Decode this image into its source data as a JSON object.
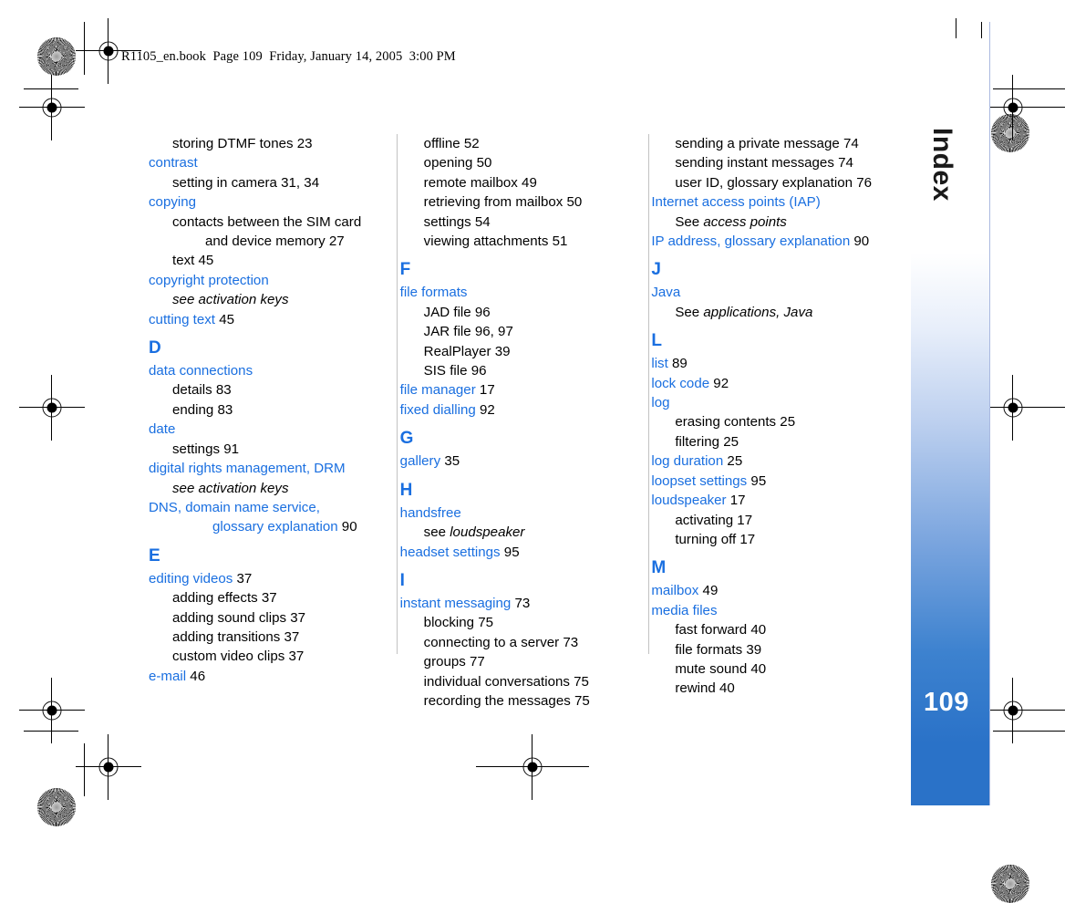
{
  "header": {
    "text": "R1105_en.book  Page 109  Friday, January 14, 2005  3:00 PM"
  },
  "sidebar": {
    "label": "Index",
    "page_number": "109",
    "gradient_top": "#ffffff",
    "gradient_bottom": "#2a72c8"
  },
  "colors": {
    "entry_blue": "#1a6fe0",
    "body_black": "#000000",
    "divider_gray": "#c2c2c2",
    "trim_blue": "#aab9e0"
  },
  "columns": [
    {
      "id": "column-1",
      "blocks": [
        {
          "type": "sub",
          "text": "storing DTMF tones",
          "page": "23"
        },
        {
          "type": "head",
          "text": "contrast"
        },
        {
          "type": "sub",
          "text": "setting in camera",
          "page": "31, 34"
        },
        {
          "type": "head",
          "text": "copying"
        },
        {
          "type": "sub",
          "text": "contacts between the SIM card and device memory",
          "page": "27",
          "hang": true
        },
        {
          "type": "sub",
          "text": "text",
          "page": "45"
        },
        {
          "type": "head",
          "text": "copyright protection"
        },
        {
          "type": "xref",
          "see": "",
          "target": "see activation keys"
        },
        {
          "type": "head",
          "text": "cutting text",
          "page": "45"
        },
        {
          "type": "letter",
          "text": "D"
        },
        {
          "type": "head",
          "text": "data connections"
        },
        {
          "type": "sub",
          "text": "details",
          "page": "83"
        },
        {
          "type": "sub",
          "text": "ending",
          "page": "83"
        },
        {
          "type": "head",
          "text": "date"
        },
        {
          "type": "sub",
          "text": "settings",
          "page": "91"
        },
        {
          "type": "head",
          "text": "digital rights management, DRM"
        },
        {
          "type": "xref",
          "see": "",
          "target": "see activation keys"
        },
        {
          "type": "head",
          "text": "DNS, domain name service, glossary explanation",
          "page": "90",
          "hang": true
        },
        {
          "type": "letter",
          "text": "E"
        },
        {
          "type": "head",
          "text": "editing videos",
          "page": "37"
        },
        {
          "type": "sub",
          "text": "adding effects",
          "page": "37"
        },
        {
          "type": "sub",
          "text": "adding sound clips",
          "page": "37"
        },
        {
          "type": "sub",
          "text": "adding transitions",
          "page": "37"
        },
        {
          "type": "sub",
          "text": "custom video clips",
          "page": "37"
        },
        {
          "type": "head",
          "text": "e-mail",
          "page": "46"
        }
      ]
    },
    {
      "id": "column-2",
      "blocks": [
        {
          "type": "sub",
          "text": "offline",
          "page": "52"
        },
        {
          "type": "sub",
          "text": "opening",
          "page": "50"
        },
        {
          "type": "sub",
          "text": "remote mailbox",
          "page": "49"
        },
        {
          "type": "sub",
          "text": "retrieving from mailbox",
          "page": "50"
        },
        {
          "type": "sub",
          "text": "settings",
          "page": "54"
        },
        {
          "type": "sub",
          "text": "viewing attachments",
          "page": "51"
        },
        {
          "type": "letter",
          "text": "F"
        },
        {
          "type": "head",
          "text": "file formats"
        },
        {
          "type": "sub",
          "text": "JAD file",
          "page": "96"
        },
        {
          "type": "sub",
          "text": "JAR file",
          "page": "96, 97"
        },
        {
          "type": "sub",
          "text": "RealPlayer",
          "page": "39"
        },
        {
          "type": "sub",
          "text": "SIS file",
          "page": "96"
        },
        {
          "type": "head",
          "text": "file manager",
          "page": "17"
        },
        {
          "type": "head",
          "text": "fixed dialling",
          "page": "92"
        },
        {
          "type": "letter",
          "text": "G"
        },
        {
          "type": "head",
          "text": "gallery",
          "page": "35"
        },
        {
          "type": "letter",
          "text": "H"
        },
        {
          "type": "head",
          "text": "handsfree"
        },
        {
          "type": "xref",
          "see": "see ",
          "target": "loudspeaker"
        },
        {
          "type": "head",
          "text": "headset settings",
          "page": "95"
        },
        {
          "type": "letter",
          "text": "I"
        },
        {
          "type": "head",
          "text": "instant messaging",
          "page": "73"
        },
        {
          "type": "sub",
          "text": "blocking",
          "page": "75"
        },
        {
          "type": "sub",
          "text": "connecting to a server",
          "page": "73"
        },
        {
          "type": "sub",
          "text": "groups",
          "page": "77"
        },
        {
          "type": "sub",
          "text": "individual conversations",
          "page": "75"
        },
        {
          "type": "sub",
          "text": "recording the messages",
          "page": "75"
        }
      ]
    },
    {
      "id": "column-3",
      "blocks": [
        {
          "type": "sub",
          "text": "sending a private message",
          "page": "74"
        },
        {
          "type": "sub",
          "text": "sending instant messages",
          "page": "74"
        },
        {
          "type": "sub",
          "text": "user ID, glossary explanation",
          "page": "76"
        },
        {
          "type": "head",
          "text": "Internet access points (IAP)"
        },
        {
          "type": "xref",
          "see": "See ",
          "target": "access points"
        },
        {
          "type": "head",
          "text": "IP address, glossary explanation",
          "page": "90"
        },
        {
          "type": "letter",
          "text": "J"
        },
        {
          "type": "head",
          "text": "Java"
        },
        {
          "type": "xref",
          "see": "See ",
          "target": "applications, Java"
        },
        {
          "type": "letter",
          "text": "L"
        },
        {
          "type": "head",
          "text": "list",
          "page": "89"
        },
        {
          "type": "head",
          "text": "lock code",
          "page": "92"
        },
        {
          "type": "head",
          "text": "log"
        },
        {
          "type": "sub",
          "text": "erasing contents",
          "page": "25"
        },
        {
          "type": "sub",
          "text": "filtering",
          "page": "25"
        },
        {
          "type": "head",
          "text": "log duration",
          "page": "25"
        },
        {
          "type": "head",
          "text": "loopset settings",
          "page": "95"
        },
        {
          "type": "head",
          "text": "loudspeaker",
          "page": "17"
        },
        {
          "type": "sub",
          "text": "activating",
          "page": "17"
        },
        {
          "type": "sub",
          "text": "turning off",
          "page": "17"
        },
        {
          "type": "letter",
          "text": "M"
        },
        {
          "type": "head",
          "text": "mailbox",
          "page": "49"
        },
        {
          "type": "head",
          "text": "media files"
        },
        {
          "type": "sub",
          "text": "fast forward",
          "page": "40"
        },
        {
          "type": "sub",
          "text": "file formats",
          "page": "39"
        },
        {
          "type": "sub",
          "text": "mute sound",
          "page": "40"
        },
        {
          "type": "sub",
          "text": "rewind",
          "page": "40"
        }
      ]
    }
  ]
}
